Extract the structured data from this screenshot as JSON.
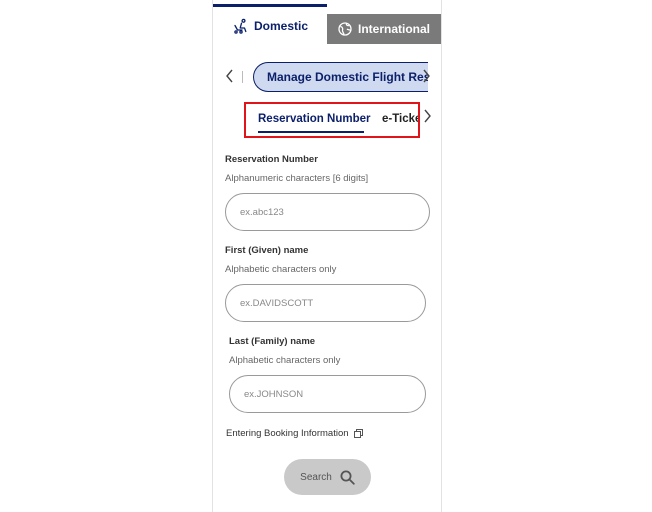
{
  "tabs": {
    "domestic": "Domestic",
    "international": "International"
  },
  "menu": {
    "current": "Manage Domestic Flight Res"
  },
  "subtabs": {
    "active": "Reservation Number",
    "other": "e-Ticke"
  },
  "form": {
    "reservation": {
      "label": "Reservation Number",
      "hint": "Alphanumeric characters [6 digits]",
      "placeholder": "ex.abc123"
    },
    "first_name": {
      "label": "First (Given) name",
      "hint": "Alphabetic characters only",
      "placeholder": "ex.DAVIDSCOTT"
    },
    "last_name": {
      "label": "Last (Family) name",
      "hint": "Alphabetic characters only",
      "placeholder": "ex.JOHNSON"
    },
    "booking_link": "Entering Booking Information",
    "search_label": "Search"
  },
  "colors": {
    "brand": "#0b1f6a",
    "highlight": "#e0151b",
    "pill": "#cfd9ef"
  },
  "icons": {
    "domestic": "airplane-seat-icon",
    "international": "globe-icon",
    "link": "external-window-icon",
    "search": "magnifier-icon"
  }
}
